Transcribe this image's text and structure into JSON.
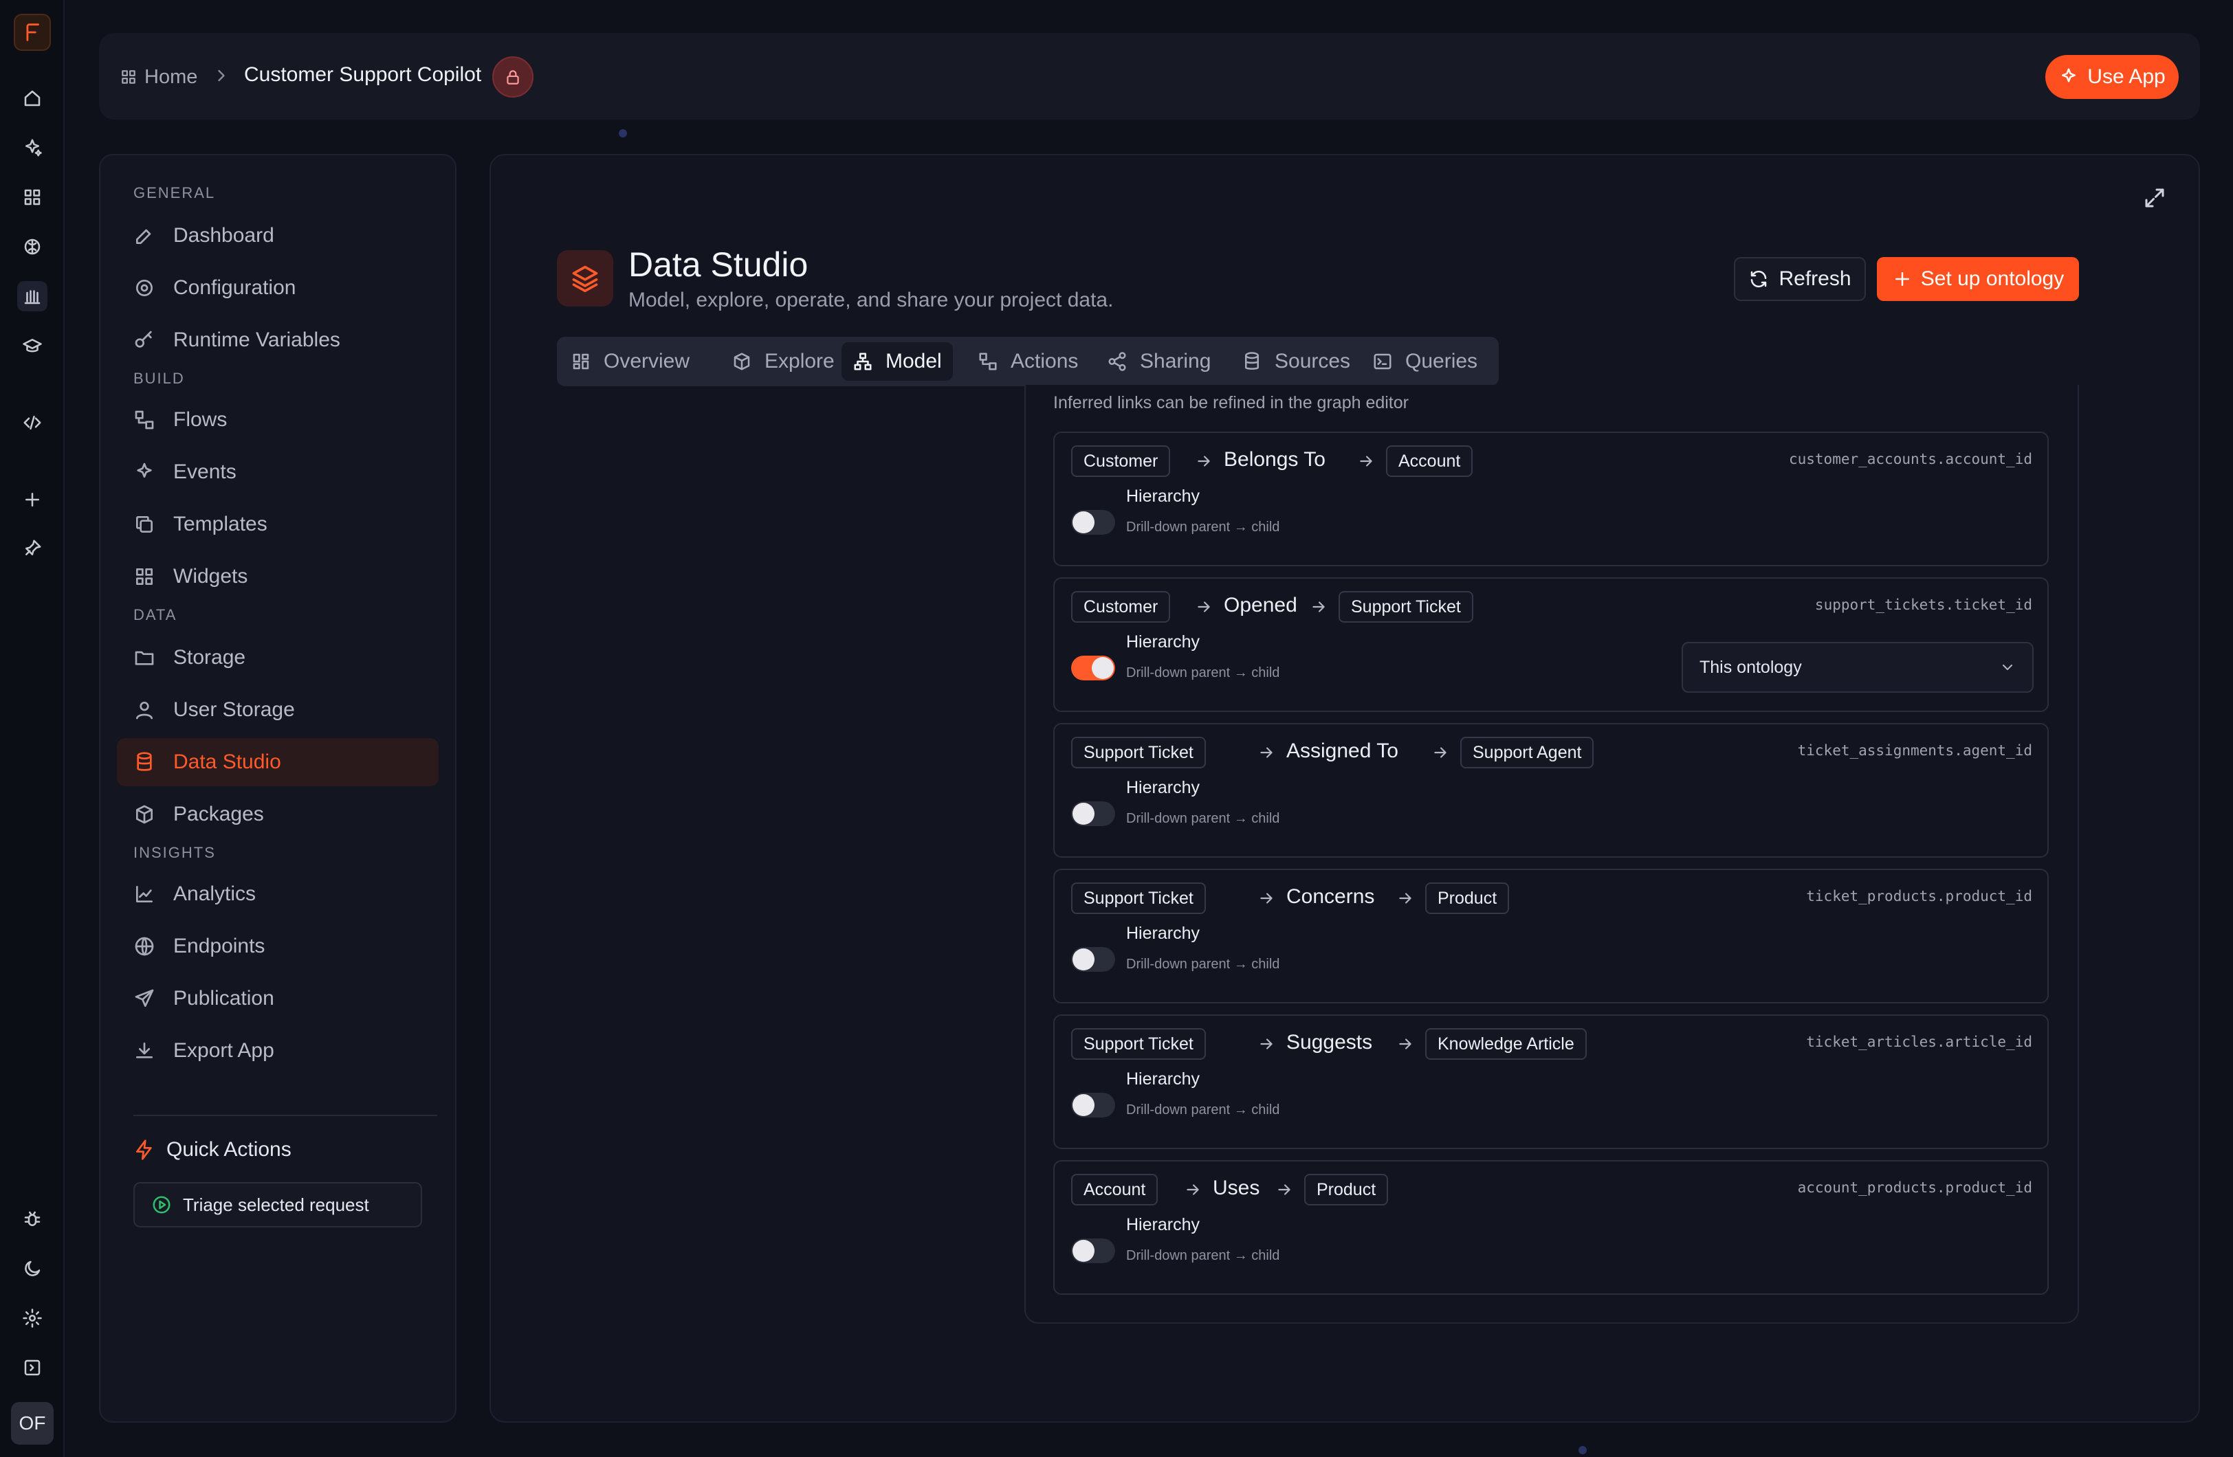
{
  "header": {
    "home": "Home",
    "title": "Customer Support Copilot",
    "use_app": "Use App"
  },
  "rail": {
    "avatar": "OF",
    "icons": [
      "logo-icon",
      "home-icon",
      "sparkle-icon",
      "grid-icon",
      "brain-icon",
      "library-icon",
      "graduation-icon",
      "code-icon",
      "plus-icon",
      "pin-icon",
      "bug-icon",
      "moon-icon",
      "gear-icon",
      "collapse-icon"
    ]
  },
  "nav": {
    "sections": {
      "general": "GENERAL",
      "build": "BUILD",
      "data": "DATA",
      "insights": "INSIGHTS"
    },
    "items": {
      "dashboard": "Dashboard",
      "configuration": "Configuration",
      "runtime_variables": "Runtime Variables",
      "flows": "Flows",
      "events": "Events",
      "templates": "Templates",
      "widgets": "Widgets",
      "storage": "Storage",
      "user_storage": "User Storage",
      "data_studio": "Data Studio",
      "packages": "Packages",
      "analytics": "Analytics",
      "endpoints": "Endpoints",
      "publication": "Publication",
      "export_app": "Export App"
    },
    "quick_actions": "Quick Actions",
    "triage": "Triage selected request"
  },
  "main": {
    "title": "Data Studio",
    "subtitle": "Model, explore, operate, and share your project data.",
    "refresh": "Refresh",
    "setup": "Set up ontology",
    "tabs": [
      "Overview",
      "Explore",
      "Model",
      "Actions",
      "Sharing",
      "Sources",
      "Queries"
    ],
    "active_tab": "Model",
    "inferred_note": "Inferred links can be refined in the graph editor"
  },
  "links": [
    {
      "from": "Customer",
      "rel": "Belongs To",
      "to": "Account",
      "column": "customer_accounts.account_id",
      "hierarchy": false
    },
    {
      "from": "Customer",
      "rel": "Opened",
      "to": "Support Ticket",
      "column": "support_tickets.ticket_id",
      "hierarchy": true,
      "scope": "This ontology"
    },
    {
      "from": "Support Ticket",
      "rel": "Assigned To",
      "to": "Support Agent",
      "column": "ticket_assignments.agent_id",
      "hierarchy": false
    },
    {
      "from": "Support Ticket",
      "rel": "Concerns",
      "to": "Product",
      "column": "ticket_products.product_id",
      "hierarchy": false
    },
    {
      "from": "Support Ticket",
      "rel": "Suggests",
      "to": "Knowledge Article",
      "column": "ticket_articles.article_id",
      "hierarchy": false
    },
    {
      "from": "Account",
      "rel": "Uses",
      "to": "Product",
      "column": "account_products.product_id",
      "hierarchy": false
    }
  ],
  "hierarchy_label": "Hierarchy",
  "hierarchy_sub": "Drill-down parent → child",
  "colors": {
    "accent": "#ff4f1f",
    "background": "#0f111a",
    "panel": "#121420",
    "success": "#2fbf6a"
  }
}
